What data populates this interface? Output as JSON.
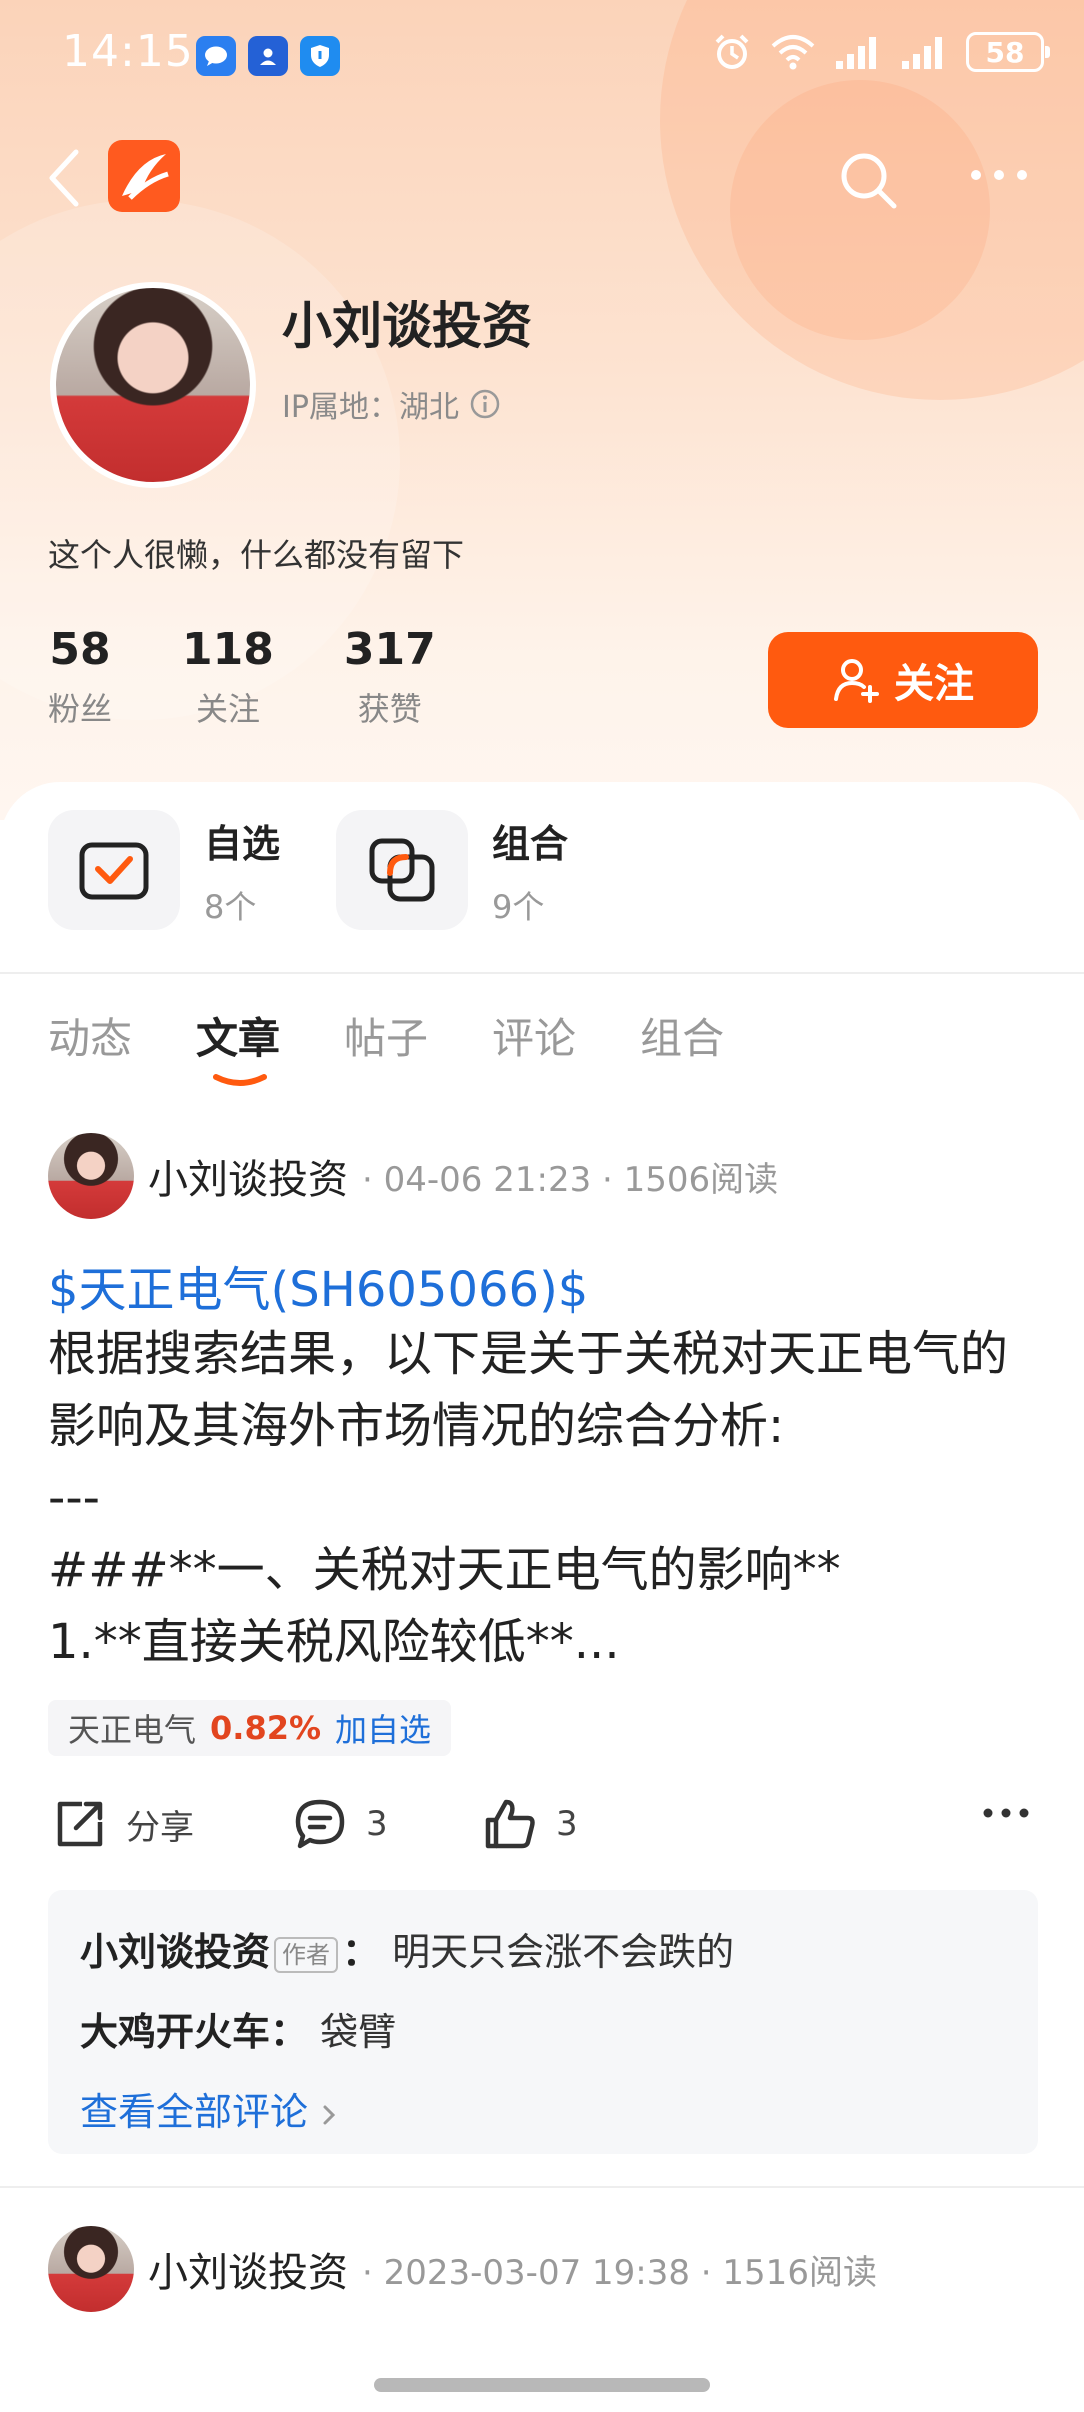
{
  "status_bar": {
    "time": "14:15",
    "battery": "58"
  },
  "colors": {
    "accent": "#ff5a0f",
    "link": "#1e6fd9",
    "up": "#e2451f"
  },
  "profile": {
    "name": "小刘谈投资",
    "ip_label": "IP属地：湖北",
    "bio": "这个人很懒，什么都没有留下",
    "follow_button": "关注"
  },
  "stats": [
    {
      "value": "58",
      "label": "粉丝"
    },
    {
      "value": "118",
      "label": "关注"
    },
    {
      "value": "317",
      "label": "获赞"
    }
  ],
  "watch": [
    {
      "title": "自选",
      "count": "8个",
      "icon": "checkbox-icon"
    },
    {
      "title": "组合",
      "count": "9个",
      "icon": "overlap-squares-icon"
    }
  ],
  "tabs": [
    {
      "label": "动态",
      "active": false
    },
    {
      "label": "文章",
      "active": true
    },
    {
      "label": "帖子",
      "active": false
    },
    {
      "label": "评论",
      "active": false
    },
    {
      "label": "组合",
      "active": false
    }
  ],
  "post": {
    "author": "小刘谈投资",
    "meta": "· 04-06 21:23 · 1506阅读",
    "stock_link": "$天正电气(SH605066)$",
    "body": "根据搜索结果，以下是关于关税对天正电气的影响及其海外市场情况的综合分析:\n---\n###**一、关税对天正电气的影响**\n1.**直接关税风险较低**...",
    "stock_chip": {
      "name": "天正电气",
      "change": "0.82%",
      "add": "加自选"
    },
    "actions": {
      "share": "分享",
      "comments": "3",
      "likes": "3"
    },
    "comments": [
      {
        "user": "小刘谈投资",
        "badge": "作者",
        "text": "明天只会涨不会跌的"
      },
      {
        "user": "大鸡开火车",
        "badge": "",
        "text": "袋臂"
      }
    ],
    "view_all": "查看全部评论"
  },
  "post2": {
    "author": "小刘谈投资",
    "meta": "· 2023-03-07 19:38 · 1516阅读"
  }
}
